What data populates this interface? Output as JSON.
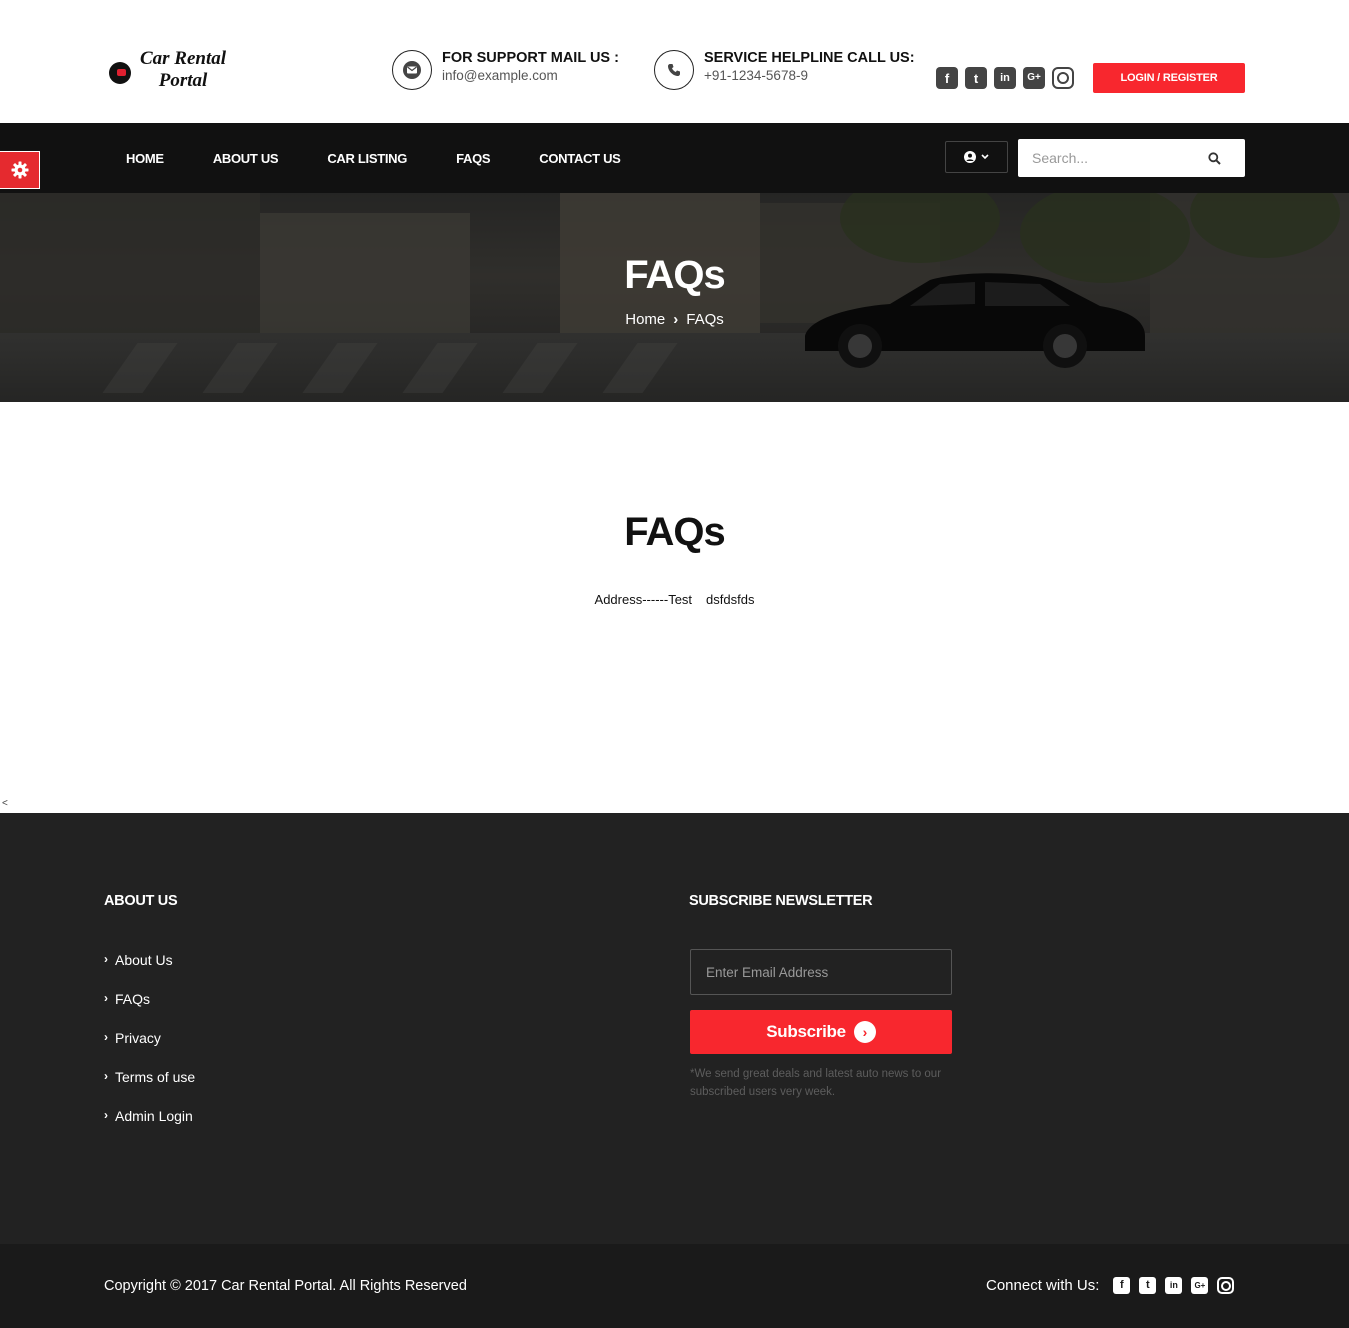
{
  "stray_chars": {
    "top": "<",
    "mid": "<"
  },
  "header": {
    "logo_line1": "Car Rental",
    "logo_line2": "Portal",
    "support_title": "FOR SUPPORT MAIL US :",
    "support_email": "info@example.com",
    "helpline_title": "SERVICE HELPLINE CALL US:",
    "helpline_phone": "+91-1234-5678-9",
    "social_icons": [
      "facebook-icon",
      "twitter-icon",
      "linkedin-icon",
      "google-plus-icon",
      "instagram-icon"
    ],
    "social_glyphs": {
      "facebook": "f",
      "twitter": "t",
      "linkedin": "in",
      "google_plus": "G+"
    },
    "login_label": "LOGIN / REGISTER"
  },
  "nav": {
    "items": [
      {
        "label": "HOME"
      },
      {
        "label": "ABOUT US"
      },
      {
        "label": "CAR LISTING"
      },
      {
        "label": "FAQS"
      },
      {
        "label": "CONTACT US"
      }
    ],
    "search_placeholder": "Search..."
  },
  "banner": {
    "title": "FAQs",
    "breadcrumb": {
      "home": "Home",
      "separator": "›",
      "current": "FAQs"
    }
  },
  "main": {
    "title": "FAQs",
    "text_part1": "Address------Test",
    "text_part2": "dsfdsfds"
  },
  "footer": {
    "about_heading": "ABOUT US",
    "links": [
      {
        "label": "About Us"
      },
      {
        "label": "FAQs"
      },
      {
        "label": "Privacy"
      },
      {
        "label": "Terms of use"
      },
      {
        "label": "Admin Login"
      }
    ],
    "newsletter_heading": "SUBSCRIBE NEWSLETTER",
    "email_placeholder": "Enter Email Address",
    "subscribe_label": "Subscribe",
    "subscribe_arrow": "›",
    "note": "*We send great deals and latest auto news to our subscribed users very week.",
    "copyright": "Copyright © 2017 Car Rental Portal. All Rights Reserved",
    "connect_label": "Connect with Us:"
  },
  "colors": {
    "accent": "#f8272e",
    "nav_bg": "#111111",
    "footer_bg": "#222222",
    "bottom_bg": "#1a1a1a"
  }
}
